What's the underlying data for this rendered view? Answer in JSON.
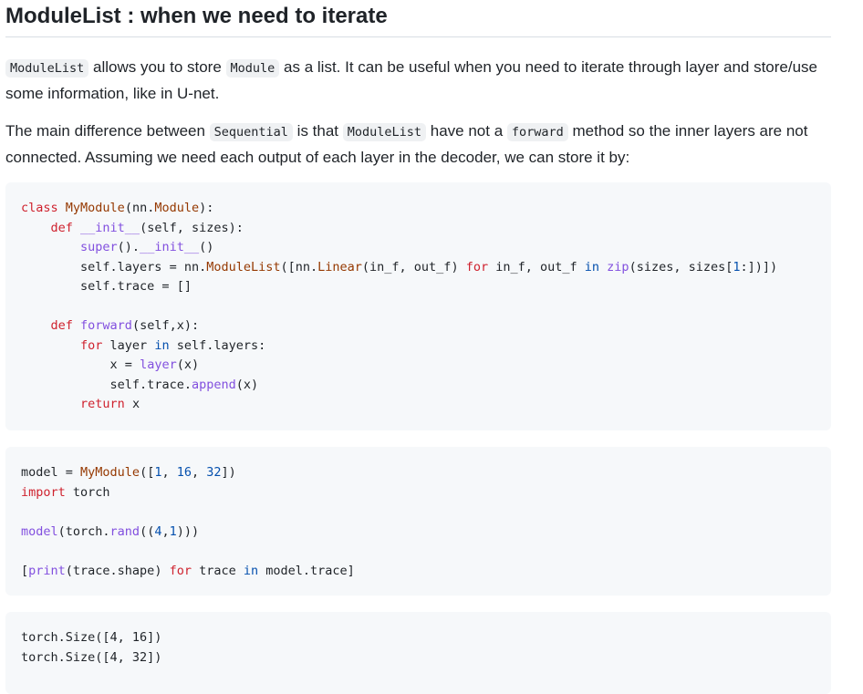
{
  "heading": "ModuleList : when we need to iterate",
  "para1": {
    "code1": "ModuleList",
    "text1": " allows you to store ",
    "code2": "Module",
    "text2": " as a list. It can be useful when you need to iterate through layer and store/use some information, like in U-net."
  },
  "para2": {
    "text1": "The main difference between ",
    "code1": "Sequential",
    "text2": " is that ",
    "code2": "ModuleList",
    "text3": " have not a ",
    "code3": "forward",
    "text4": " method so the inner layers are not connected. Assuming we need each output of each layer in the decoder, we can store it by:"
  },
  "code_block_1": {
    "l1": {
      "a": "class ",
      "b": "MyModule",
      "c": "(nn.",
      "d": "Module",
      "e": "):"
    },
    "l2": {
      "ind": "    ",
      "a": "def ",
      "b": "__init__",
      "c": "(self, sizes):"
    },
    "l3": {
      "ind": "        ",
      "a": "super",
      "b": "().",
      "c": "__init__",
      "d": "()"
    },
    "l4": {
      "ind": "        ",
      "a": "self.layers = nn.",
      "b": "ModuleList",
      "c": "([nn.",
      "d": "Linear",
      "e": "(in_f, out_f) ",
      "f": "for",
      "g": " in_f, out_f ",
      "h": "in",
      "i": " ",
      "j": "zip",
      "k": "(sizes, sizes[",
      "l": "1",
      "m": ":])])"
    },
    "l5": {
      "ind": "        ",
      "a": "self.trace = []"
    },
    "l6": {
      "a": ""
    },
    "l7": {
      "ind": "    ",
      "a": "def ",
      "b": "forward",
      "c": "(self,x):"
    },
    "l8": {
      "ind": "        ",
      "a": "for",
      "b": " layer ",
      "c": "in",
      "d": " self.layers:"
    },
    "l9": {
      "ind": "            ",
      "a": "x = ",
      "b": "layer",
      "c": "(x)"
    },
    "l10": {
      "ind": "            ",
      "a": "self.trace.",
      "b": "append",
      "c": "(x)"
    },
    "l11": {
      "ind": "        ",
      "a": "return",
      "b": " x"
    }
  },
  "code_block_2": {
    "l1": {
      "a": "model = ",
      "b": "MyModule",
      "c": "([",
      "d": "1",
      "e": ", ",
      "f": "16",
      "g": ", ",
      "h": "32",
      "i": "])"
    },
    "l2": {
      "a": "import",
      "b": " torch"
    },
    "l3": {
      "a": ""
    },
    "l4": {
      "a": "model",
      "b": "(torch.",
      "c": "rand",
      "d": "((",
      "e": "4",
      "f": ",",
      "g": "1",
      "h": ")))"
    },
    "l5": {
      "a": ""
    },
    "l6": {
      "a": "[",
      "b": "print",
      "c": "(trace.shape) ",
      "d": "for",
      "e": " trace ",
      "f": "in",
      "g": " model.trace]"
    }
  },
  "output_block": {
    "l1": "torch.Size([4, 16])",
    "l2": "torch.Size([4, 32])"
  },
  "colors": {
    "keyword": "#cf222e",
    "builtin": "#8250df",
    "type": "#953800",
    "number": "#0550ae",
    "code_bg": "#f6f8fa",
    "inline_code_bg": "#eff1f3"
  }
}
